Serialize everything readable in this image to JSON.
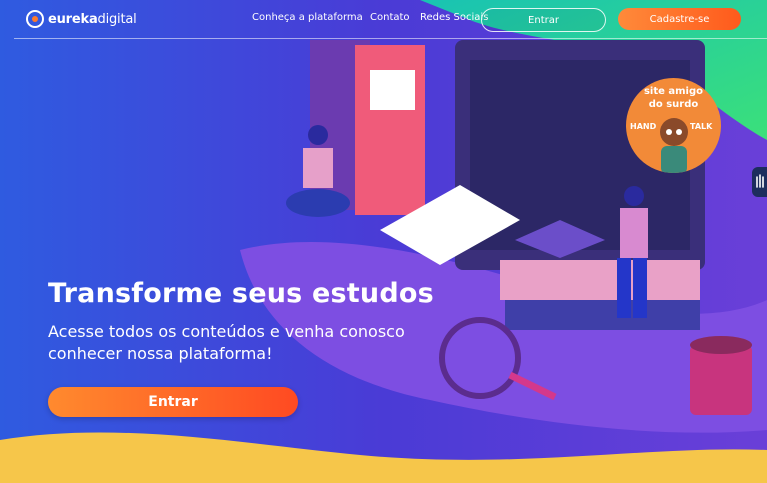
{
  "brand": {
    "logo_bold": "eureka",
    "logo_regular": "digital"
  },
  "nav": {
    "links": [
      "Conheça a plataforma",
      "Contato",
      "Redes Sociais"
    ],
    "login_label": "Entrar",
    "signup_label": "Cadastre-se"
  },
  "hero": {
    "title": "Transforme seus estudos",
    "subtitle_line1": "Acesse todos os conteúdos e venha conosco",
    "subtitle_line2": "conhecer nossa plataforma!",
    "cta_label": "Entrar"
  },
  "accessibility": {
    "badge_line1": "site amigo",
    "badge_line2": "do surdo",
    "badge_left": "HAND",
    "badge_right": "TALK",
    "tab_icon": "hand-icon"
  },
  "colors": {
    "accent": "#ff6a24",
    "background": "#3b3fd8"
  }
}
